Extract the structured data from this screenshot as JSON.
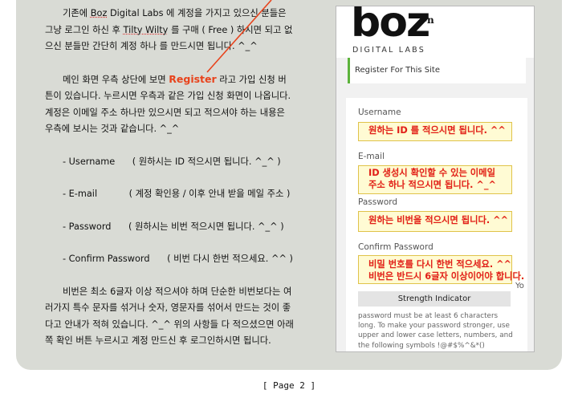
{
  "article": {
    "p1_before": "기존에 ",
    "p1_boz": "Boz",
    "p1_mid": " Digital Labs 에 계정을 가지고 있으신 분들은 그냥 로그인 하신 후 ",
    "p1_tilty": "Tilty Wilty",
    "p1_after": " 를 구매 ( Free ) 하시면  되고 없으신 분들만 간단히 계정 하나 를 만드시면 됩니다. ^_^",
    "p2_before": "메인 화면 우측 상단에 보면 ",
    "p2_register": "Register",
    "p2_after": " 라고 가입 신청 버튼이 있습니다. 누르시면 우측과 같은 가입 신청 화면이 나옵니다. 계정은 이메일 주소 하나만 있으시면 되고 적으셔야 하는 내용은 우측에 보시는 것과 같습니다. ^_^",
    "items": [
      "- Username      ( 원하시는 ID 적으시면 됩니다. ^_^ )",
      "- E-mail           ( 계정 확인용 / 이후 안내 받을 메일 주소 )",
      "- Password      ( 원하시는 비번 적으시면 됩니다. ^_^ )",
      "- Confirm Password      ( 비번 다시 한번 적으세요. ^^ )"
    ],
    "p3": "비번은 최소 6글자 이상 적으셔야 하며 단순한 비번보다는 여러가지 특수 문자를 섞거나 숫자, 영문자를 섞어서 만드는 것이 좋다고 안내가 적혀 있습니다. ^_^ 위의 사항들 다 적으셨으면 아래쪽 확인 버튼 누르시고 계정 만드신 후 로그인하시면 됩니다."
  },
  "screenshot": {
    "logo": "boz",
    "logo_sup": "-n",
    "logo_sub": "DIGITAL LABS",
    "register_title": "Register For This Site",
    "username_label": "Username",
    "username_note": "원하는 ID 를 적으시면 됩니다. ^^",
    "email_label": "E-mail",
    "email_note": "ID 생성시 확인할 수 있는 이메일\n주소 하나 적으시면 됩니다. ^_^",
    "password_label": "Password",
    "password_note": "원하는 비번을 적으시면 됩니다. ^^",
    "confirm_label": "Confirm Password",
    "confirm_note": "비밀 번호를 다시 한번 적으세요. ^^\n비번은 반드시 6글자 이상이어야 합니다.",
    "you_fragment": "Yo",
    "strength_label": "Strength Indicator",
    "password_hint": "password must be at least 6 characters long. To make your password stronger, use upper and lower case letters, numbers, and the following symbols !@#$%^&*()"
  },
  "footer": {
    "page_label": "[ Page 2 ]"
  },
  "colors": {
    "panel_bg": "#d9dbd5",
    "highlight_text": "#e8431c",
    "note_text": "#e11d1d",
    "note_bg": "#fffbd4",
    "register_bar_accent": "#5cb33b"
  }
}
